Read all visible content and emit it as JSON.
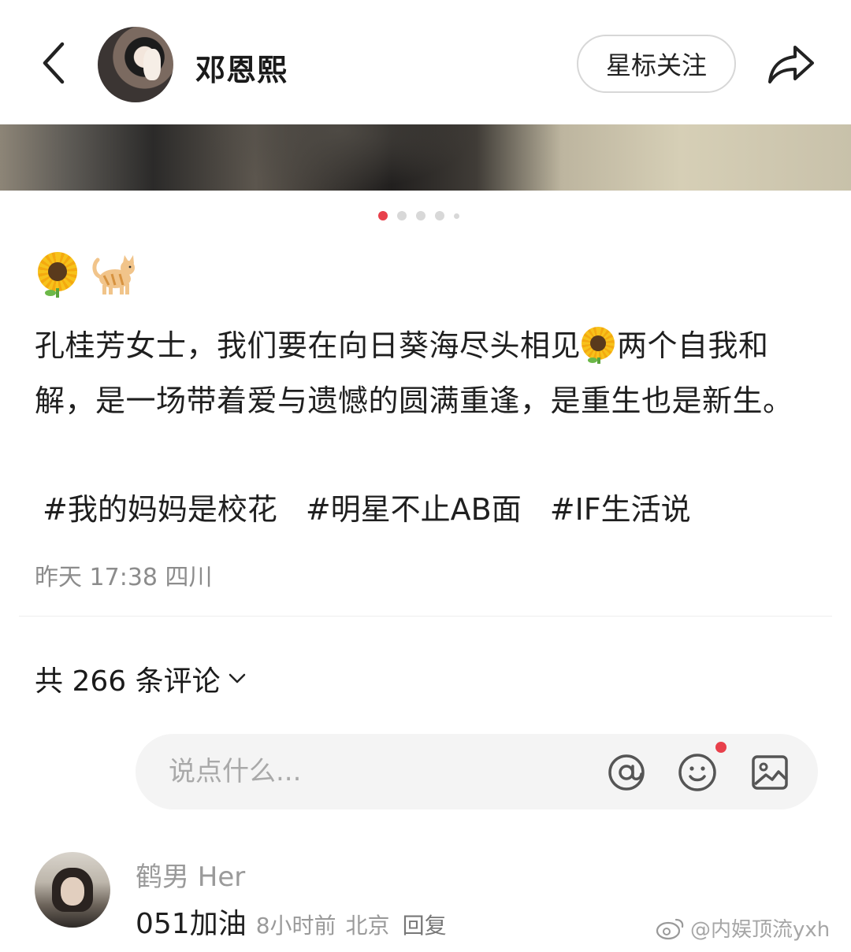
{
  "header": {
    "username": "邓恩熙",
    "follow_label": "星标关注"
  },
  "carousel": {
    "total_dots": 5,
    "active_index": 0
  },
  "post": {
    "emojis": [
      "sunflower",
      "cat"
    ],
    "text_part1": "孔桂芳女士，我们要在向日葵海尽头相见",
    "text_part2": "两个自我和解，是一场带着爱与遗憾的圆满重逢，是重生也是新生。",
    "tags": [
      "#我的妈妈是校花",
      "#明星不止AB面",
      "#IF生活说"
    ],
    "meta": "昨天 17:38 四川"
  },
  "comments": {
    "count_label": "共 266 条评论",
    "input_placeholder": "说点什么...",
    "items": [
      {
        "user": "鹤男 Her",
        "text": "051加油",
        "time": "8小时前",
        "location": "北京",
        "reply_label": "回复"
      }
    ]
  },
  "watermark": "@内娱顶流yxh",
  "colors": {
    "accent_red": "#e8404b",
    "text_gray": "#8c8c8c"
  }
}
